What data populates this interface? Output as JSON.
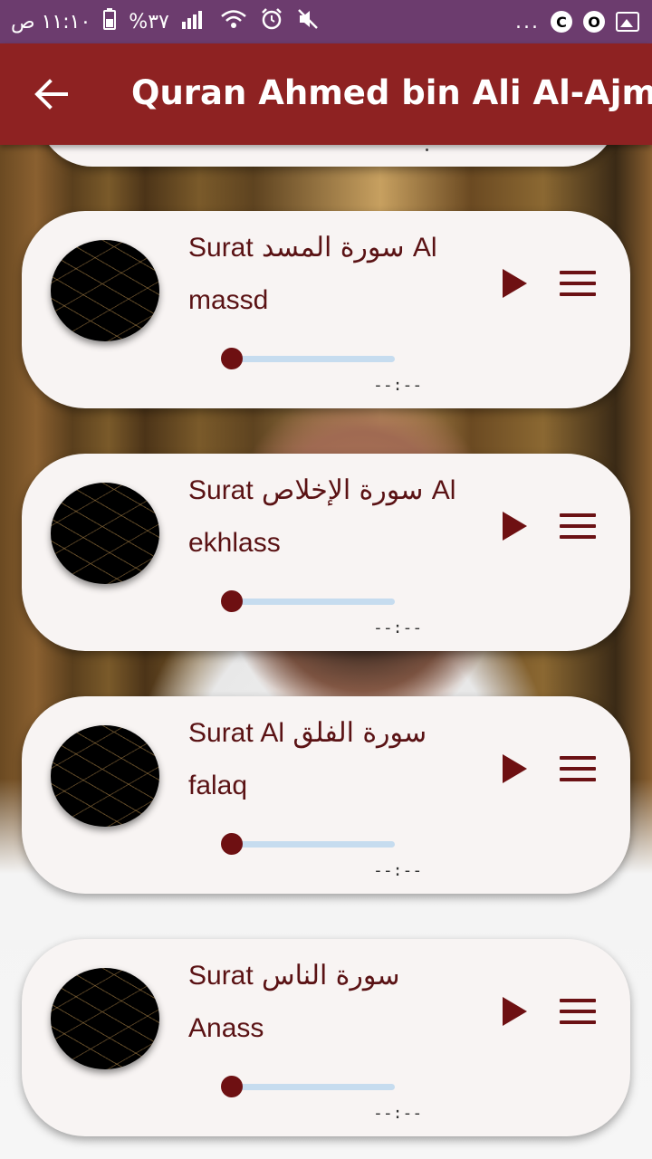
{
  "status_bar": {
    "time": "١١:١٠ ص",
    "battery": "%٣٧",
    "more": "..."
  },
  "app_bar": {
    "title": "Quran Ahmed bin Ali Al-Ajmi"
  },
  "tracks": [
    {
      "title": "Surat سورة المسد Al massd",
      "time": "--:--",
      "progress": 0
    },
    {
      "title": "Surat سورة الإخلاص Al ekhlass",
      "time": "--:--",
      "progress": 0
    },
    {
      "title": "Surat Al سورة الفلق falaq",
      "time": "--:--",
      "progress": 0
    },
    {
      "title": "Surat سورة الناس Anass",
      "time": "--:--",
      "progress": 0
    }
  ],
  "colors": {
    "status_bar": "#6c3c6e",
    "app_bar": "#8e2222",
    "accent": "#6e1012",
    "card": "#f8f4f3",
    "slider_track": "#c6dcef"
  }
}
